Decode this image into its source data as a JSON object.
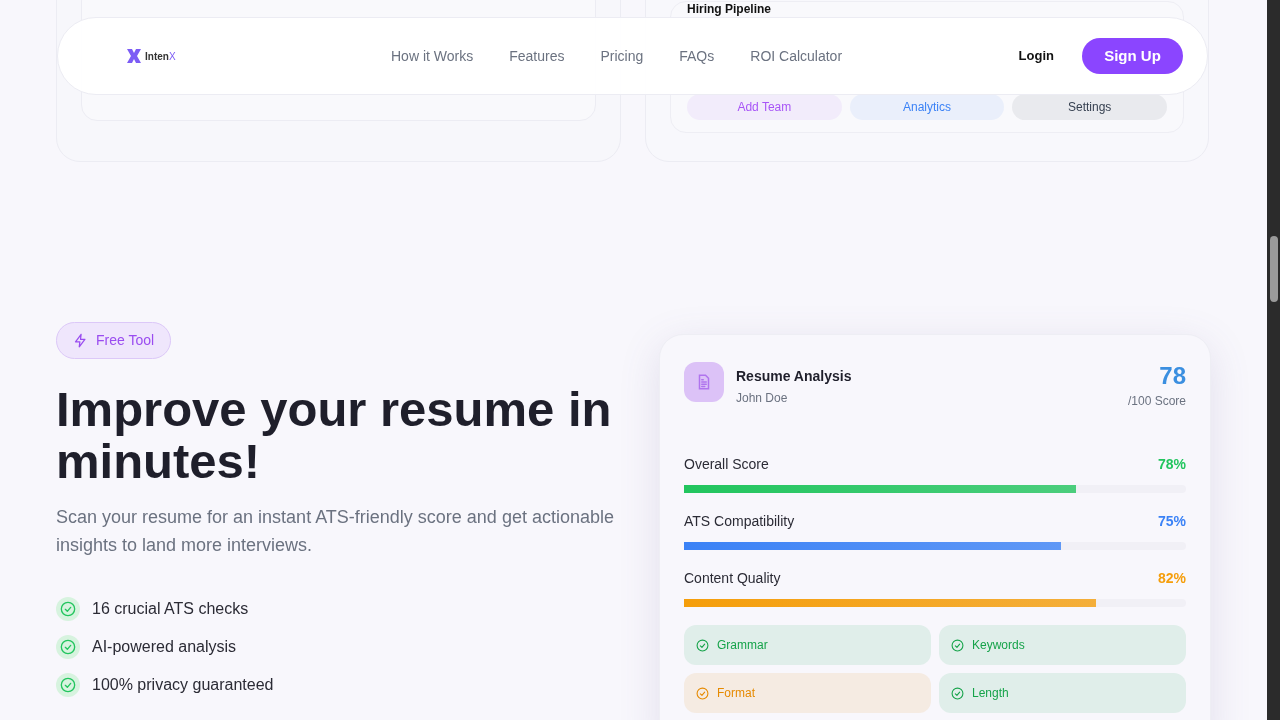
{
  "top_cards": {
    "right_title": "Hiring Pipeline",
    "actions": [
      {
        "label": "Add Team",
        "color": "#a855f7"
      },
      {
        "label": "Analytics",
        "color": "#3b82f6"
      },
      {
        "label": "Settings",
        "color": "#374151"
      }
    ]
  },
  "nav": {
    "brand": {
      "name": "Inten",
      "accent": "X"
    },
    "links": [
      "How it Works",
      "Features",
      "Pricing",
      "FAQs",
      "ROI Calculator"
    ],
    "login": "Login",
    "signup": "Sign Up"
  },
  "hero": {
    "badge": "Free Tool",
    "title": "Improve your resume in minutes!",
    "subtitle": "Scan your resume for an instant ATS-friendly score and get actionable insights to land more interviews.",
    "features": [
      "16 crucial ATS checks",
      "AI-powered analysis",
      "100% privacy guaranteed"
    ]
  },
  "card": {
    "title": "Resume Analysis",
    "name": "John Doe",
    "score": "78",
    "score_caption": "/100 Score",
    "metrics": [
      {
        "label": "Overall Score",
        "value": "78%",
        "level": 0.78,
        "color": "#22c55e"
      },
      {
        "label": "ATS Compatibility",
        "value": "75%",
        "level": 0.75,
        "color": "#3b82f6"
      },
      {
        "label": "Content Quality",
        "value": "82%",
        "level": 0.82,
        "color": "#f59e0b"
      }
    ],
    "checks": [
      {
        "label": "Grammar",
        "color": "#16a34a"
      },
      {
        "label": "Keywords",
        "color": "#16a34a"
      },
      {
        "label": "Format",
        "color": "#e68a00"
      },
      {
        "label": "Length",
        "color": "#16a34a"
      }
    ]
  }
}
